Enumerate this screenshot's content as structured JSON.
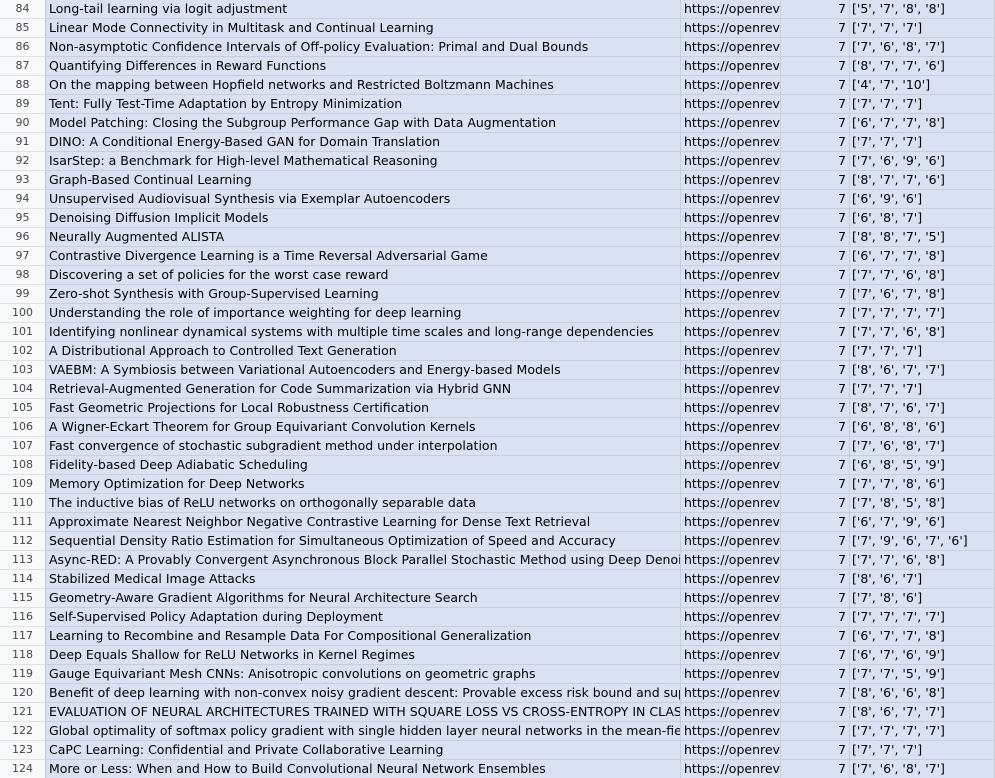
{
  "sheet": {
    "rows": [
      {
        "num": "84",
        "title": "Long-tail learning via logit adjustment",
        "url": "https://openrevi",
        "count": "7",
        "scores": "['5', '7', '8', '8']"
      },
      {
        "num": "85",
        "title": "Linear Mode Connectivity in Multitask and Continual Learning",
        "url": "https://openrevi",
        "count": "7",
        "scores": "['7', '7', '7']"
      },
      {
        "num": "86",
        "title": "Non-asymptotic Confidence Intervals of Off-policy Evaluation:  Primal and Dual Bounds",
        "url": "https://openrevi",
        "count": "7",
        "scores": "['7', '6', '8', '7']"
      },
      {
        "num": "87",
        "title": "Quantifying Differences in Reward Functions",
        "url": "https://openrevi",
        "count": "7",
        "scores": "['8', '7', '7', '6']"
      },
      {
        "num": "88",
        "title": "On the mapping between Hopfield networks and Restricted Boltzmann Machines",
        "url": "https://openrevi",
        "count": "7",
        "scores": "['4', '7', '10']"
      },
      {
        "num": "89",
        "title": "Tent: Fully Test-Time Adaptation by Entropy Minimization",
        "url": "https://openrevi",
        "count": "7",
        "scores": "['7', '7', '7']"
      },
      {
        "num": "90",
        "title": "Model Patching: Closing the Subgroup Performance Gap with Data Augmentation",
        "url": "https://openrevi",
        "count": "7",
        "scores": "['6', '7', '7', '8']"
      },
      {
        "num": "91",
        "title": "DINO: A Conditional Energy-Based GAN for Domain Translation",
        "url": "https://openrevi",
        "count": "7",
        "scores": "['7', '7', '7']"
      },
      {
        "num": "92",
        "title": "IsarStep: a Benchmark for High-level Mathematical Reasoning",
        "url": "https://openrevi",
        "count": "7",
        "scores": "['7', '6', '9', '6']"
      },
      {
        "num": "93",
        "title": "Graph-Based Continual Learning",
        "url": "https://openrevi",
        "count": "7",
        "scores": "['8', '7', '7', '6']"
      },
      {
        "num": "94",
        "title": "Unsupervised Audiovisual Synthesis via Exemplar Autoencoders",
        "url": "https://openrevi",
        "count": "7",
        "scores": "['6', '9', '6']"
      },
      {
        "num": "95",
        "title": "Denoising Diffusion Implicit Models",
        "url": "https://openrevi",
        "count": "7",
        "scores": "['6', '8', '7']"
      },
      {
        "num": "96",
        "title": "Neurally Augmented ALISTA",
        "url": "https://openrevi",
        "count": "7",
        "scores": "['8', '8', '7', '5']"
      },
      {
        "num": "97",
        "title": "Contrastive Divergence Learning is a Time Reversal Adversarial Game",
        "url": "https://openrevi",
        "count": "7",
        "scores": "['6', '7', '7', '8']"
      },
      {
        "num": "98",
        "title": "Discovering a set of policies for the worst case reward",
        "url": "https://openrevi",
        "count": "7",
        "scores": "['7', '7', '6', '8']"
      },
      {
        "num": "99",
        "title": "Zero-shot Synthesis with Group-Supervised Learning",
        "url": "https://openrevi",
        "count": "7",
        "scores": "['7', '6', '7', '8']"
      },
      {
        "num": "100",
        "title": "Understanding the role of importance weighting for deep learning",
        "url": "https://openrevi",
        "count": "7",
        "scores": "['7', '7', '7', '7']"
      },
      {
        "num": "101",
        "title": "Identifying nonlinear dynamical systems with multiple time scales and long-range dependencies",
        "url": "https://openrevi",
        "count": "7",
        "scores": "['7', '7', '6', '8']"
      },
      {
        "num": "102",
        "title": "A Distributional Approach to Controlled Text Generation",
        "url": "https://openrevi",
        "count": "7",
        "scores": "['7', '7', '7']"
      },
      {
        "num": "103",
        "title": "VAEBM: A Symbiosis between Variational Autoencoders and Energy-based Models",
        "url": "https://openrevi",
        "count": "7",
        "scores": "['8', '6', '7', '7']"
      },
      {
        "num": "104",
        "title": "Retrieval-Augmented Generation for Code Summarization via Hybrid GNN",
        "url": "https://openrevi",
        "count": "7",
        "scores": "['7', '7', '7']"
      },
      {
        "num": "105",
        "title": "Fast Geometric Projections for Local Robustness Certification",
        "url": "https://openrevi",
        "count": "7",
        "scores": "['8', '7', '6', '7']"
      },
      {
        "num": "106",
        "title": "A Wigner-Eckart Theorem for Group Equivariant Convolution Kernels",
        "url": "https://openrevi",
        "count": "7",
        "scores": "['6', '8', '8', '6']"
      },
      {
        "num": "107",
        "title": "Fast convergence of stochastic subgradient method under interpolation",
        "url": "https://openrevi",
        "count": "7",
        "scores": "['7', '6', '8', '7']"
      },
      {
        "num": "108",
        "title": "Fidelity-based Deep Adiabatic Scheduling",
        "url": "https://openrevi",
        "count": "7",
        "scores": "['6', '8', '5', '9']"
      },
      {
        "num": "109",
        "title": "Memory Optimization for Deep Networks",
        "url": "https://openrevi",
        "count": "7",
        "scores": "['7', '7', '8', '6']"
      },
      {
        "num": "110",
        "title": "The inductive bias of ReLU networks on orthogonally separable data",
        "url": "https://openrevi",
        "count": "7",
        "scores": "['7', '8', '5', '8']"
      },
      {
        "num": "111",
        "title": "Approximate Nearest Neighbor Negative Contrastive Learning for Dense Text Retrieval",
        "url": "https://openrevi",
        "count": "7",
        "scores": "['6', '7', '9', '6']"
      },
      {
        "num": "112",
        "title": "Sequential Density Ratio Estimation for Simultaneous Optimization of Speed and Accuracy",
        "url": "https://openrevi",
        "count": "7",
        "scores": "['7', '9', '6', '7', '6']"
      },
      {
        "num": "113",
        "title": "Async-RED: A Provably Convergent Asynchronous Block Parallel Stochastic Method using Deep Denoising P",
        "url": "https://openrevi",
        "count": "7",
        "scores": "['7', '7', '6', '8']"
      },
      {
        "num": "114",
        "title": "Stabilized Medical Image Attacks",
        "url": "https://openrevi",
        "count": "7",
        "scores": "['8', '6', '7']"
      },
      {
        "num": "115",
        "title": "Geometry-Aware Gradient Algorithms for Neural Architecture Search",
        "url": "https://openrevi",
        "count": "7",
        "scores": "['7', '8', '6']"
      },
      {
        "num": "116",
        "title": "Self-Supervised Policy Adaptation during Deployment",
        "url": "https://openrevi",
        "count": "7",
        "scores": "['7', '7', '7', '7']"
      },
      {
        "num": "117",
        "title": "Learning to Recombine and Resample Data For Compositional Generalization",
        "url": "https://openrevi",
        "count": "7",
        "scores": "['6', '7', '7', '8']"
      },
      {
        "num": "118",
        "title": "Deep Equals Shallow for ReLU Networks in Kernel Regimes",
        "url": "https://openrevi",
        "count": "7",
        "scores": "['6', '7', '6', '9']"
      },
      {
        "num": "119",
        "title": "Gauge Equivariant Mesh CNNs: Anisotropic convolutions on geometric graphs",
        "url": "https://openrevi",
        "count": "7",
        "scores": "['7', '7', '5', '9']"
      },
      {
        "num": "120",
        "title": "Benefit of deep learning with non-convex noisy gradient descent: Provable excess risk bound and superiori",
        "url": "https://openrevi",
        "count": "7",
        "scores": "['8', '6', '6', '8']"
      },
      {
        "num": "121",
        "title": "EVALUATION OF NEURAL ARCHITECTURES TRAINED WITH SQUARE LOSS VS CROSS-ENTROPY IN CLASSIFICA",
        "url": "https://openrevi",
        "count": "7",
        "scores": "['8', '6', '7', '7']"
      },
      {
        "num": "122",
        "title": "Global optimality of softmax policy gradient with single hidden layer neural networks in the mean-field reg",
        "url": "https://openrevi",
        "count": "7",
        "scores": "['7', '7', '7', '7']"
      },
      {
        "num": "123",
        "title": "CaPC Learning: Confidential and Private Collaborative Learning",
        "url": "https://openrevi",
        "count": "7",
        "scores": "['7', '7', '7']"
      },
      {
        "num": "124",
        "title": "More or Less: When and How to Build Convolutional Neural Network Ensembles",
        "url": "https://openrevi",
        "count": "7",
        "scores": "['7', '6', '8', '7']"
      }
    ]
  },
  "colors": {
    "row_fill": "#d9e1f2",
    "header_fill": "#f8f9fa",
    "grid_line": "#c8cfdb"
  }
}
